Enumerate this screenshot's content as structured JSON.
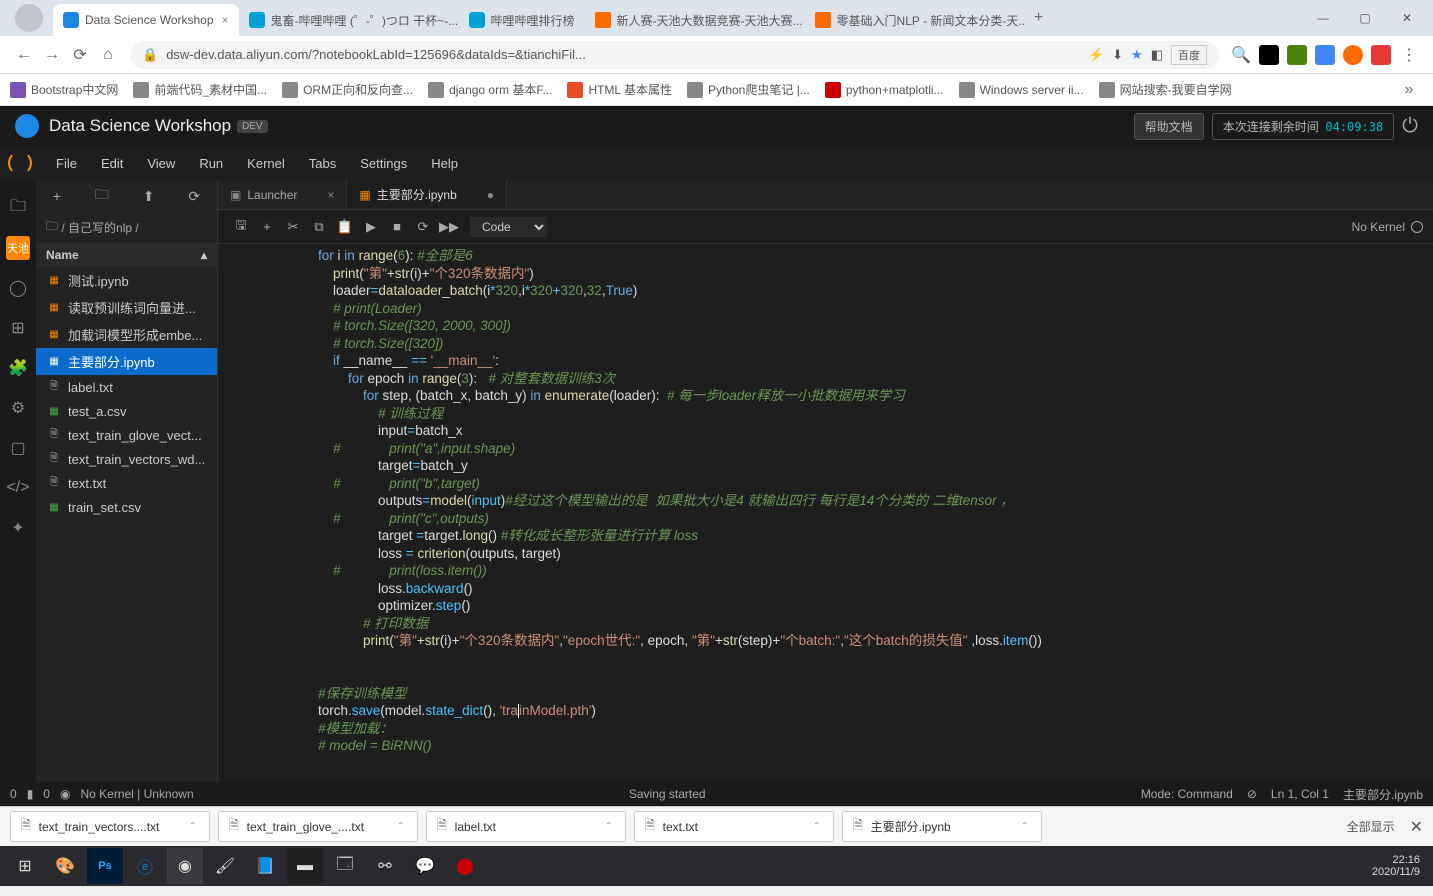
{
  "browser": {
    "tabs": [
      {
        "title": "Data Science Workshop",
        "icon": "#1e88e5",
        "active": true
      },
      {
        "title": "鬼畜-哔哩哔哩 (゜-゜)つロ 干杯~-...",
        "icon": "#00a1d6"
      },
      {
        "title": "哔哩哔哩排行榜",
        "icon": "#00a1d6"
      },
      {
        "title": "新人赛-天池大数据竞赛-天池大赛...",
        "icon": "#ff6a00"
      },
      {
        "title": "零基础入门NLP - 新闻文本分类-天...",
        "icon": "#ff6a00"
      }
    ],
    "url": "dsw-dev.data.aliyun.com/?notebookLabId=125696&dataIds=&tianchiFil...",
    "ext_text": "百度"
  },
  "bookmarks": [
    "Bootstrap中文网",
    "前端代码_素材中国...",
    "ORM正向和反向查...",
    "django orm 基本F...",
    "HTML 基本属性",
    "Python爬虫笔记 |...",
    "python+matplotli...",
    "Windows server ii...",
    "网站搜索-我要自学网"
  ],
  "dsw": {
    "title": "Data Science Workshop",
    "badge": "DEV",
    "help_doc": "帮助文档",
    "remaining_label": "本次连接剩余时间",
    "timer": "04:09:38"
  },
  "menu": [
    "File",
    "Edit",
    "View",
    "Run",
    "Kernel",
    "Tabs",
    "Settings",
    "Help"
  ],
  "activity_label": "天池",
  "sidebar": {
    "breadcrumb": "/ 自己写的nlp /",
    "name_header": "Name",
    "files": [
      {
        "name": "测试.ipynb",
        "type": "ipynb"
      },
      {
        "name": "读取预训练词向量进...",
        "type": "ipynb"
      },
      {
        "name": "加载词模型形成embe...",
        "type": "ipynb"
      },
      {
        "name": "主要部分.ipynb",
        "type": "ipynb",
        "selected": true
      },
      {
        "name": "label.txt",
        "type": "txt"
      },
      {
        "name": "test_a.csv",
        "type": "csv"
      },
      {
        "name": "text_train_glove_vect...",
        "type": "txt"
      },
      {
        "name": "text_train_vectors_wd...",
        "type": "txt"
      },
      {
        "name": "text.txt",
        "type": "txt"
      },
      {
        "name": "train_set.csv",
        "type": "csv"
      }
    ]
  },
  "editor_tabs": [
    {
      "label": "Launcher",
      "icon": "▦",
      "active": false,
      "close": "×"
    },
    {
      "label": "主要部分.ipynb",
      "icon": "▦",
      "active": true,
      "close": "●"
    }
  ],
  "toolbar_select": "Code",
  "kernel_status": "No Kernel",
  "status": {
    "left_a": "0",
    "left_b": "0",
    "kernel": "No Kernel | Unknown",
    "center": "Saving started",
    "mode": "Mode: Command",
    "pos": "Ln 1, Col 1",
    "file": "主要部分.ipynb"
  },
  "downloads": [
    "text_train_vectors....txt",
    "text_train_glove_....txt",
    "label.txt",
    "text.txt",
    "主要部分.ipynb"
  ],
  "download_all": "全部显示",
  "clock": {
    "time": "22:16",
    "date": "2020/11/9"
  }
}
